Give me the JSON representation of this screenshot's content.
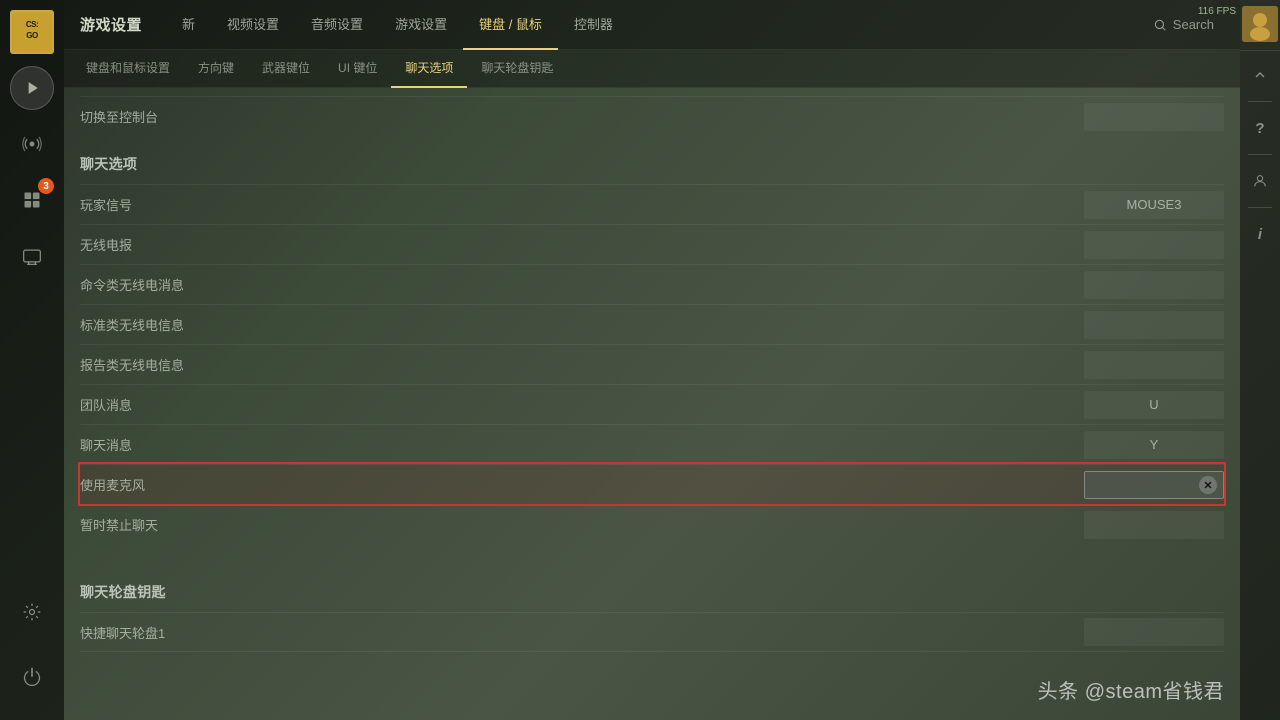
{
  "app": {
    "title": "游戏设置",
    "fps": "116 FPS"
  },
  "sidebar": {
    "items": [
      {
        "id": "logo",
        "label": "CS:GO"
      },
      {
        "id": "play",
        "icon": "play"
      },
      {
        "id": "signal",
        "icon": "signal"
      },
      {
        "id": "notifications",
        "icon": "notifications",
        "badge": "3"
      },
      {
        "id": "tv",
        "icon": "tv"
      },
      {
        "id": "settings",
        "icon": "settings"
      }
    ]
  },
  "topnav": {
    "tabs": [
      {
        "id": "new",
        "label": "新"
      },
      {
        "id": "video",
        "label": "视频设置"
      },
      {
        "id": "audio",
        "label": "音频设置"
      },
      {
        "id": "game",
        "label": "游戏设置"
      },
      {
        "id": "keybind",
        "label": "键盘 / 鼠标",
        "active": true
      },
      {
        "id": "controller",
        "label": "控制器"
      }
    ],
    "search": "Search"
  },
  "subnav": {
    "tabs": [
      {
        "id": "keyboard",
        "label": "键盘和鼠标设置"
      },
      {
        "id": "direction",
        "label": "方向键"
      },
      {
        "id": "weapon",
        "label": "武器键位"
      },
      {
        "id": "ui",
        "label": "UI 键位"
      },
      {
        "id": "chat",
        "label": "聊天选项",
        "active": true
      },
      {
        "id": "chatwheel",
        "label": "聊天轮盘钥匙"
      }
    ]
  },
  "content": {
    "console_row": "切换至控制台",
    "chat_section_title": "聊天选项",
    "rows": [
      {
        "id": "player_signal",
        "label": "玩家信号",
        "value": "MOUSE3"
      },
      {
        "id": "radio",
        "label": "无线电报",
        "value": ""
      },
      {
        "id": "command_radio",
        "label": "命令类无线电消息",
        "value": ""
      },
      {
        "id": "standard_radio",
        "label": "标准类无线电信息",
        "value": ""
      },
      {
        "id": "report_radio",
        "label": "报告类无线电信息",
        "value": ""
      },
      {
        "id": "team_msg",
        "label": "团队消息",
        "value": "U"
      },
      {
        "id": "chat_msg",
        "label": "聊天消息",
        "value": "Y"
      },
      {
        "id": "microphone",
        "label": "使用麦克风",
        "value": "",
        "highlighted": true
      },
      {
        "id": "mute_chat",
        "label": "暂时禁止聊天",
        "value": ""
      }
    ],
    "chat_wheel_section_title": "聊天轮盘钥匙",
    "chat_wheel_rows": [
      {
        "id": "quick_chat1",
        "label": "快捷聊天轮盘1",
        "value": ""
      }
    ]
  },
  "watermark": "头条 @steam省钱君",
  "right_sidebar": {
    "icons": [
      "up-arrow",
      "question",
      "user",
      "info"
    ]
  }
}
